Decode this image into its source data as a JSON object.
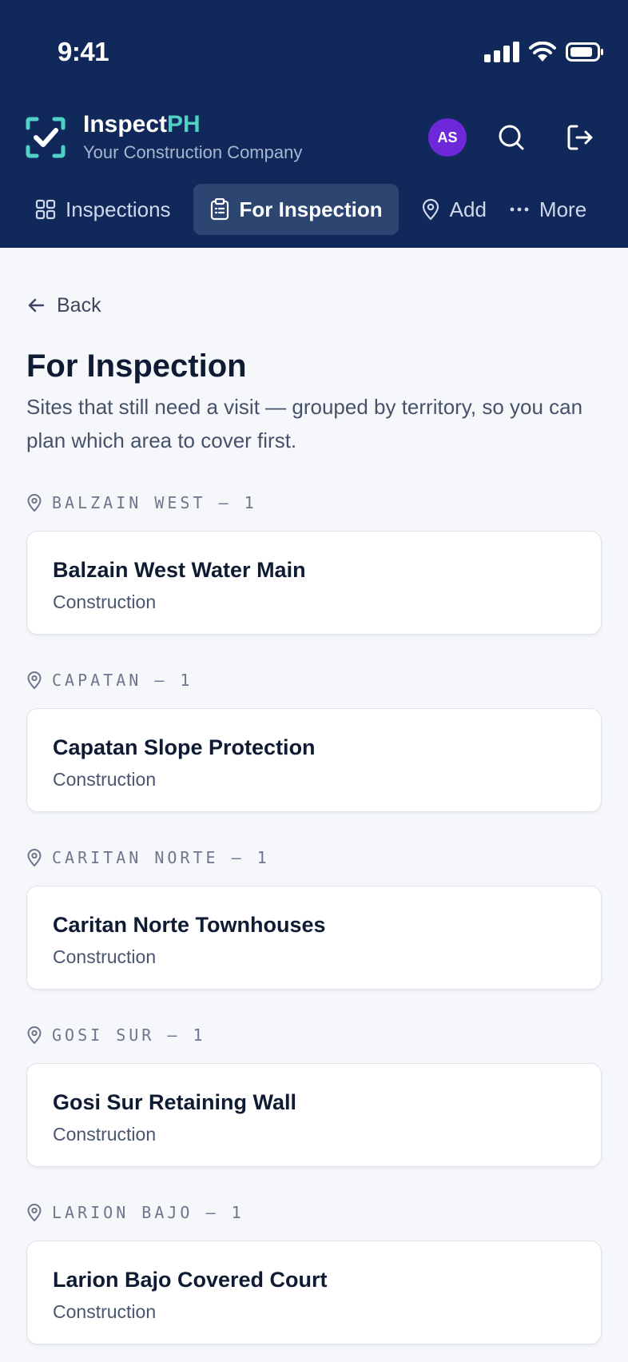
{
  "status_bar": {
    "time": "9:41"
  },
  "brand": {
    "name_primary": "Inspect",
    "name_accent": "PH",
    "subtitle": "Your Construction Company"
  },
  "user": {
    "initials": "AS"
  },
  "icons": {
    "logo": "check-square-icon",
    "search": "search-icon",
    "logout": "logout-icon",
    "back": "arrow-left-icon",
    "territory": "map-pin-icon"
  },
  "colors": {
    "header_bg": "#11295a",
    "accent": "#4fd1c5",
    "avatar_bg": "#6d28d9",
    "active_tab_bg": "#2c4571"
  },
  "nav": {
    "tabs": [
      {
        "label": "Inspections",
        "icon": "grid-icon"
      },
      {
        "label": "For Inspection",
        "icon": "clipboard-icon",
        "active": true
      },
      {
        "label": "Add",
        "icon": "map-pin-icon"
      },
      {
        "label": "More",
        "icon": "more-dots-icon"
      }
    ]
  },
  "page": {
    "back_label": "Back",
    "title": "For Inspection",
    "description": "Sites that still need a visit — grouped by territory, so you can plan which area to cover first."
  },
  "groups": [
    {
      "territory": "BALZAIN WEST — 1",
      "items": [
        {
          "name": "Balzain West Water Main",
          "type": "Construction"
        }
      ]
    },
    {
      "territory": "CAPATAN — 1",
      "items": [
        {
          "name": "Capatan Slope Protection",
          "type": "Construction"
        }
      ]
    },
    {
      "territory": "CARITAN NORTE — 1",
      "items": [
        {
          "name": "Caritan Norte Townhouses",
          "type": "Construction"
        }
      ]
    },
    {
      "territory": "GOSI SUR — 1",
      "items": [
        {
          "name": "Gosi Sur Retaining Wall",
          "type": "Construction"
        }
      ]
    },
    {
      "territory": "LARION BAJO — 1",
      "items": [
        {
          "name": "Larion Bajo Covered Court",
          "type": "Construction"
        }
      ]
    }
  ]
}
